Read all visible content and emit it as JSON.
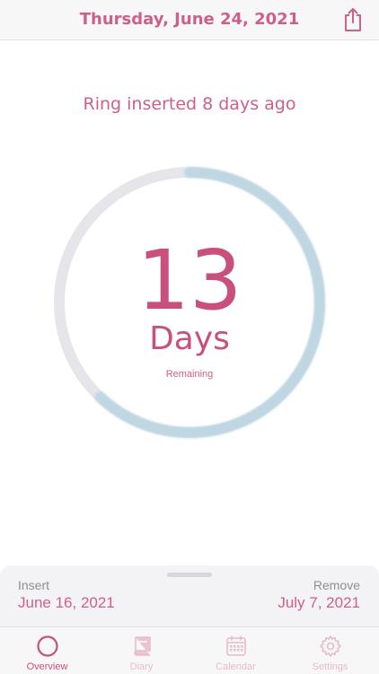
{
  "header": {
    "title": "Thursday, June 24, 2021",
    "share_icon": "share-icon"
  },
  "status": {
    "inserted_text": "Ring inserted 8 days ago"
  },
  "countdown": {
    "number": "13",
    "unit": "Days",
    "caption": "Remaining",
    "days_elapsed": 8,
    "days_remaining": 13,
    "progress_fraction_remaining": 0.62
  },
  "schedule": {
    "insert_label": "Insert",
    "insert_date": "June 16, 2021",
    "remove_label": "Remove",
    "remove_date": "July 7, 2021"
  },
  "tabs": [
    {
      "label": "Overview",
      "icon": "circle-icon",
      "active": true
    },
    {
      "label": "Diary",
      "icon": "book-icon",
      "active": false
    },
    {
      "label": "Calendar",
      "icon": "calendar-icon",
      "active": false
    },
    {
      "label": "Settings",
      "icon": "gear-icon",
      "active": false
    }
  ],
  "colors": {
    "accent": "#c9507c",
    "ring_track": "#e5e5ea",
    "ring_progress": "#bfd6e3",
    "tab_inactive": "#e6bccb"
  }
}
